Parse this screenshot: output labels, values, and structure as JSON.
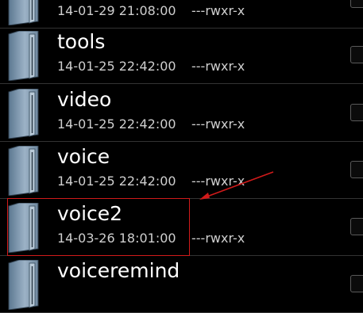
{
  "files": [
    {
      "name": "",
      "date": "14-01-29 21:08:00",
      "perm": "---rwxr-x",
      "icon": "folder-icon"
    },
    {
      "name": "tools",
      "date": "14-01-25 22:42:00",
      "perm": "---rwxr-x",
      "icon": "folder-icon"
    },
    {
      "name": "video",
      "date": "14-01-25 22:42:00",
      "perm": "---rwxr-x",
      "icon": "folder-icon"
    },
    {
      "name": "voice",
      "date": "14-01-25 22:42:00",
      "perm": "---rwxr-x",
      "icon": "folder-icon"
    },
    {
      "name": "voice2",
      "date": "14-03-26 18:01:00",
      "perm": "---rwxr-x",
      "icon": "folder-icon"
    },
    {
      "name": "voiceremind",
      "date": "",
      "perm": "",
      "icon": "folder-icon"
    }
  ],
  "annotation": {
    "color": "#d01a1a",
    "highlighted_item": "voice2"
  },
  "colors": {
    "background": "#000000",
    "divider": "#333333",
    "folder": "#8aa2b8"
  }
}
